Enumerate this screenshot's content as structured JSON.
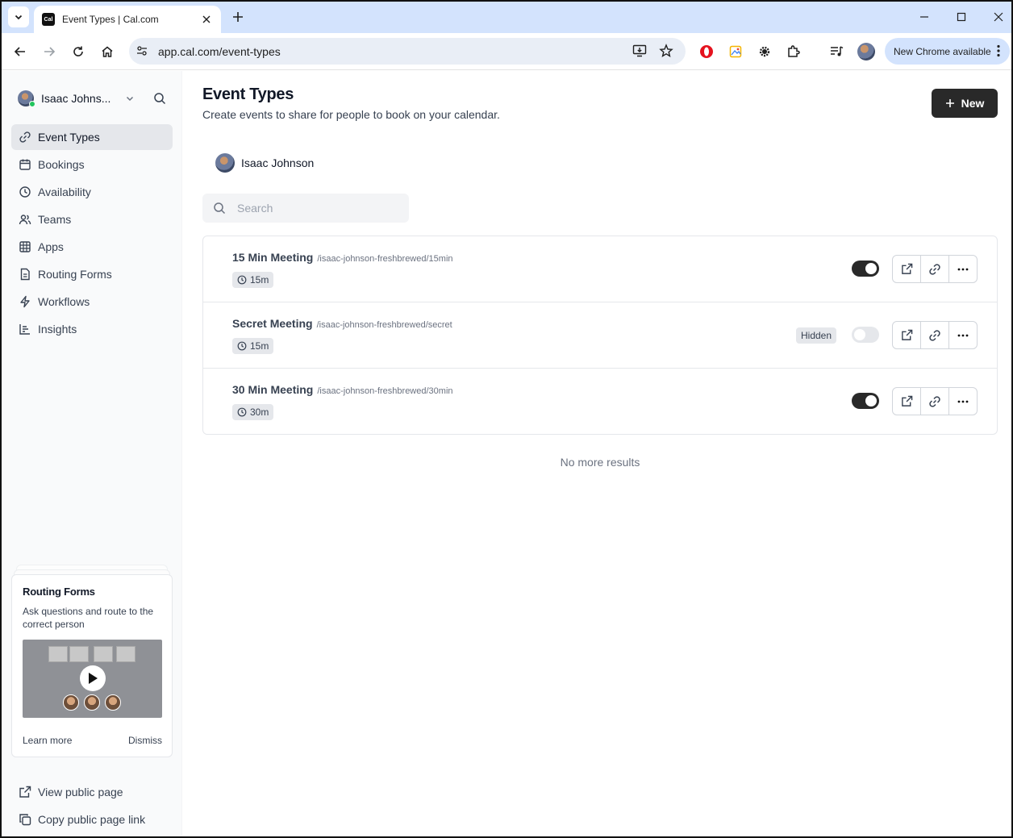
{
  "browser": {
    "tab_title": "Event Types | Cal.com",
    "favicon_text": "Cal",
    "url": "app.cal.com/event-types",
    "update_pill": "New Chrome available"
  },
  "sidebar": {
    "user_name": "Isaac Johns...",
    "nav": [
      {
        "label": "Event Types",
        "icon": "link-icon",
        "active": true
      },
      {
        "label": "Bookings",
        "icon": "calendar-icon"
      },
      {
        "label": "Availability",
        "icon": "clock-icon"
      },
      {
        "label": "Teams",
        "icon": "users-icon"
      },
      {
        "label": "Apps",
        "icon": "grid-icon"
      },
      {
        "label": "Routing Forms",
        "icon": "file-icon"
      },
      {
        "label": "Workflows",
        "icon": "zap-icon"
      },
      {
        "label": "Insights",
        "icon": "bar-chart-icon"
      }
    ],
    "promo": {
      "title": "Routing Forms",
      "description": "Ask questions and route to the correct person",
      "learn_more": "Learn more",
      "dismiss": "Dismiss"
    },
    "bottom_links": [
      {
        "label": "View public page",
        "icon": "external-link-icon"
      },
      {
        "label": "Copy public page link",
        "icon": "copy-icon"
      }
    ]
  },
  "main": {
    "title": "Event Types",
    "subtitle": "Create events to share for people to book on your calendar.",
    "new_button": "New",
    "profile_name": "Isaac Johnson",
    "search_placeholder": "Search",
    "events": [
      {
        "name": "15 Min Meeting",
        "slug": "/isaac-johnson-freshbrewed/15min",
        "duration": "15m",
        "enabled": true,
        "hidden_label": ""
      },
      {
        "name": "Secret Meeting",
        "slug": "/isaac-johnson-freshbrewed/secret",
        "duration": "15m",
        "enabled": false,
        "hidden_label": "Hidden"
      },
      {
        "name": "30 Min Meeting",
        "slug": "/isaac-johnson-freshbrewed/30min",
        "duration": "30m",
        "enabled": true,
        "hidden_label": ""
      }
    ],
    "no_more": "No more results"
  }
}
